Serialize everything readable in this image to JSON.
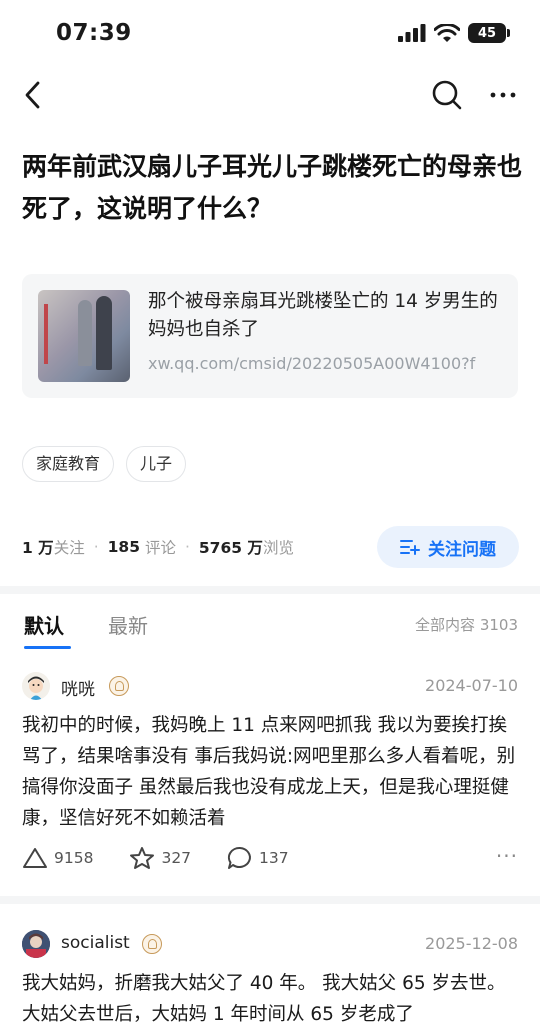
{
  "status": {
    "time": "07:39",
    "battery": "45"
  },
  "nav": {
    "back_icon": "chevron-left",
    "search_icon": "magnifier",
    "more_icon": "three-dots"
  },
  "question": {
    "title": "两年前武汉扇儿子耳光儿子跳楼死亡的母亲也死了，这说明了什么？",
    "link": {
      "title": "那个被母亲扇耳光跳楼坠亡的 14 岁男生的妈妈也自杀了",
      "url": "xw.qq.com/cmsid/20220505A00W4100?f"
    },
    "tags": [
      "家庭教育",
      "儿子"
    ],
    "stats": {
      "followers_value": "1 万",
      "followers_label": "关注",
      "comments_value": "185",
      "comments_label": "评论",
      "views_value": "5765 万",
      "views_label": "浏览"
    },
    "follow_button": "关注问题"
  },
  "tabs": {
    "default": "默认",
    "latest": "最新",
    "total": "全部内容 3103"
  },
  "answers": [
    {
      "author": "咣咣",
      "date": "2024-07-10",
      "content": "我初中的时候，我妈晚上 11 点来网吧抓我 我以为要挨打挨骂了，结果啥事没有 事后我妈说:网吧里那么多人看着呢，别搞得你没面子 虽然最后我也没有成龙上天，但是我心理挺健康，坚信好死不如赖活着",
      "likes": "9158",
      "favorites": "327",
      "comments": "137"
    },
    {
      "author": "socialist",
      "date": "2025-12-08",
      "content": "我大姑妈，折磨我大姑父了 40 年。 我大姑父 65 岁去世。 大姑父去世后，大姑妈 1 年时间从 65 岁老成了"
    }
  ],
  "colors": {
    "accent": "#1772f6",
    "follow_bg": "#eaf2fd",
    "badge": "#c79a5b"
  }
}
